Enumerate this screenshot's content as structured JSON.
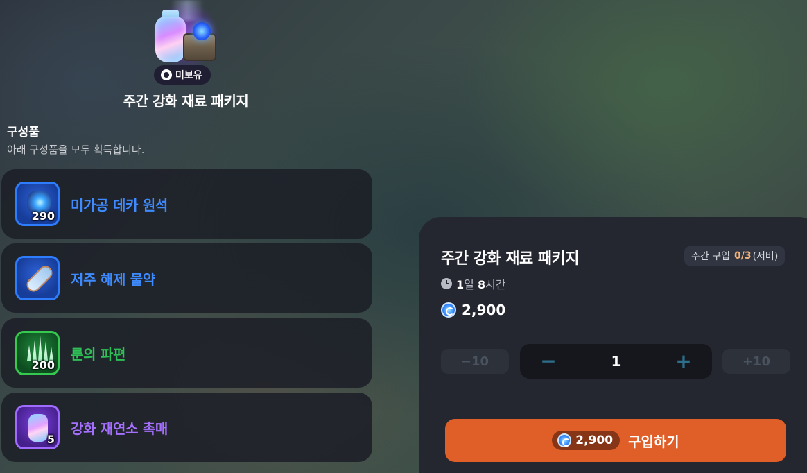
{
  "package": {
    "title": "주간 강화 재료 패키지",
    "owned_badge": "미보유"
  },
  "components": {
    "title": "구성품",
    "description": "아래 구성품을 모두 획득합니다.",
    "items": [
      {
        "name": "미가공 데카 원석",
        "count": "290",
        "name_color": "#3d8bff",
        "icon": "raw-deca-stone-icon"
      },
      {
        "name": "저주 해제 물약",
        "count": "",
        "name_color": "#3d8bff",
        "icon": "curse-removal-potion-icon"
      },
      {
        "name": "룬의 파편",
        "count": "200",
        "name_color": "#2fbf57",
        "icon": "rune-fragment-icon"
      },
      {
        "name": "강화 재연소 촉매",
        "count": "5",
        "name_color": "#a670ff",
        "icon": "enhancement-catalyst-icon"
      }
    ]
  },
  "purchase": {
    "title": "주간 강화 재료 패키지",
    "limit": {
      "prefix": "주간 구입",
      "value": "0/3",
      "suffix": "(서버)"
    },
    "timer": {
      "days": "1",
      "day_unit": "일",
      "hours": "8",
      "hour_unit": "시간"
    },
    "price": "2,900",
    "quantity": {
      "minus10": "−10",
      "minus": "−",
      "value": "1",
      "plus": "+",
      "plus10": "+10"
    },
    "buy_button": {
      "price": "2,900",
      "label": "구입하기"
    },
    "colors": {
      "accent": "#e05f28",
      "limit_value": "#f2b47a"
    }
  }
}
